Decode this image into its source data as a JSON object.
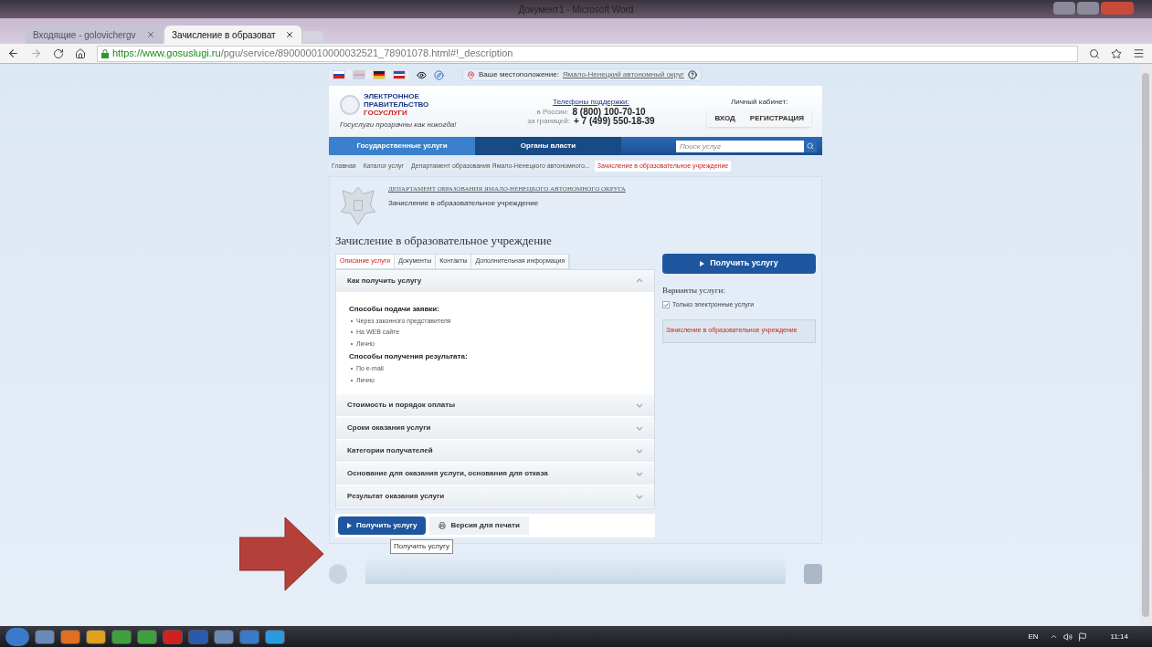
{
  "window": {
    "title": "Документ1 - Microsoft Word"
  },
  "browser": {
    "tabs": [
      {
        "label": "Входящие - golovichergv",
        "selected": false
      },
      {
        "label": "Зачисление в образоват",
        "selected": true
      }
    ],
    "url_host": "https://www.gosuslugi.ru",
    "url_path": "/pgu/service/890000010000032521_78901078.html#!_description"
  },
  "page": {
    "location_label": "Ваше местоположение:",
    "location": "Ямало-Ненецкий автономный округ",
    "logo": {
      "line1": "ЭЛЕКТРОННОЕ",
      "line2": "ПРАВИТЕЛЬСТВО",
      "line3": "ГОСУСЛУГИ",
      "slogan": "Госуслуги прозрачны как никогда!"
    },
    "support": {
      "title": "Телефоны поддержки:",
      "rows": [
        {
          "label": "в России:",
          "phone": "8 (800) 100-70-10"
        },
        {
          "label": "за границей:",
          "phone": "+ 7 (499) 550-18-39"
        }
      ]
    },
    "cabinet": {
      "title": "Личный кабинет:",
      "buttons": [
        "ВХОД",
        "РЕГИСТРАЦИЯ"
      ]
    },
    "nav": [
      {
        "label": "Государственные услуги",
        "selected": true
      },
      {
        "label": "Органы власти",
        "selected": false
      }
    ],
    "search": {
      "placeholder": "Поиск услуг"
    },
    "breadcrumbs": [
      {
        "label": "Главная",
        "current": false
      },
      {
        "label": "Каталог услуг",
        "current": false
      },
      {
        "label": "Департамент образования Ямало-Ненецкого автономного...",
        "current": false
      },
      {
        "label": "Зачисление в образовательное учреждение",
        "current": true
      }
    ],
    "department": "ДЕПАРТАМЕНТ ОБРАЗОВАНИЯ ЯМАЛО-НЕНЕЦКОГО АВТОНОМНОГО ОКРУГА",
    "department_service": "Зачисление в образовательное учреждение",
    "title": "Зачисление в образовательное учреждение",
    "tabs": [
      {
        "label": "Описание услуги",
        "selected": true
      },
      {
        "label": "Документы",
        "selected": false
      },
      {
        "label": "Контакты",
        "selected": false
      },
      {
        "label": "Дополнительная информация",
        "selected": false
      }
    ],
    "accordion": [
      {
        "title": "Как получить услугу",
        "expanded": true,
        "content": [
          {
            "heading": "Способы подачи заявки:",
            "items": [
              "Через законного представителя",
              "На WEB сайте",
              "Лично"
            ]
          },
          {
            "heading": "Способы получения результата:",
            "items": [
              "По e-mail",
              "Лично"
            ]
          }
        ]
      },
      {
        "title": "Стоимость и порядок оплаты",
        "expanded": false
      },
      {
        "title": "Сроки оказания услуги",
        "expanded": false
      },
      {
        "title": "Категории получателей",
        "expanded": false
      },
      {
        "title": "Основание для оказания услуги, основания для отказа",
        "expanded": false
      },
      {
        "title": "Результат оказания услуги",
        "expanded": false
      }
    ],
    "get_button": "Получить услугу",
    "print_button": "Версия для печати",
    "tooltip": "Получить услугу",
    "side": {
      "button": "Получить услугу",
      "variants_title": "Варианты услуги:",
      "only_electronic": {
        "label": "Только электронные услуги",
        "checked": true
      },
      "variant": "Зачисление в образовательное учреждение"
    }
  },
  "taskbar": {
    "language": "EN",
    "time": "11:14"
  }
}
